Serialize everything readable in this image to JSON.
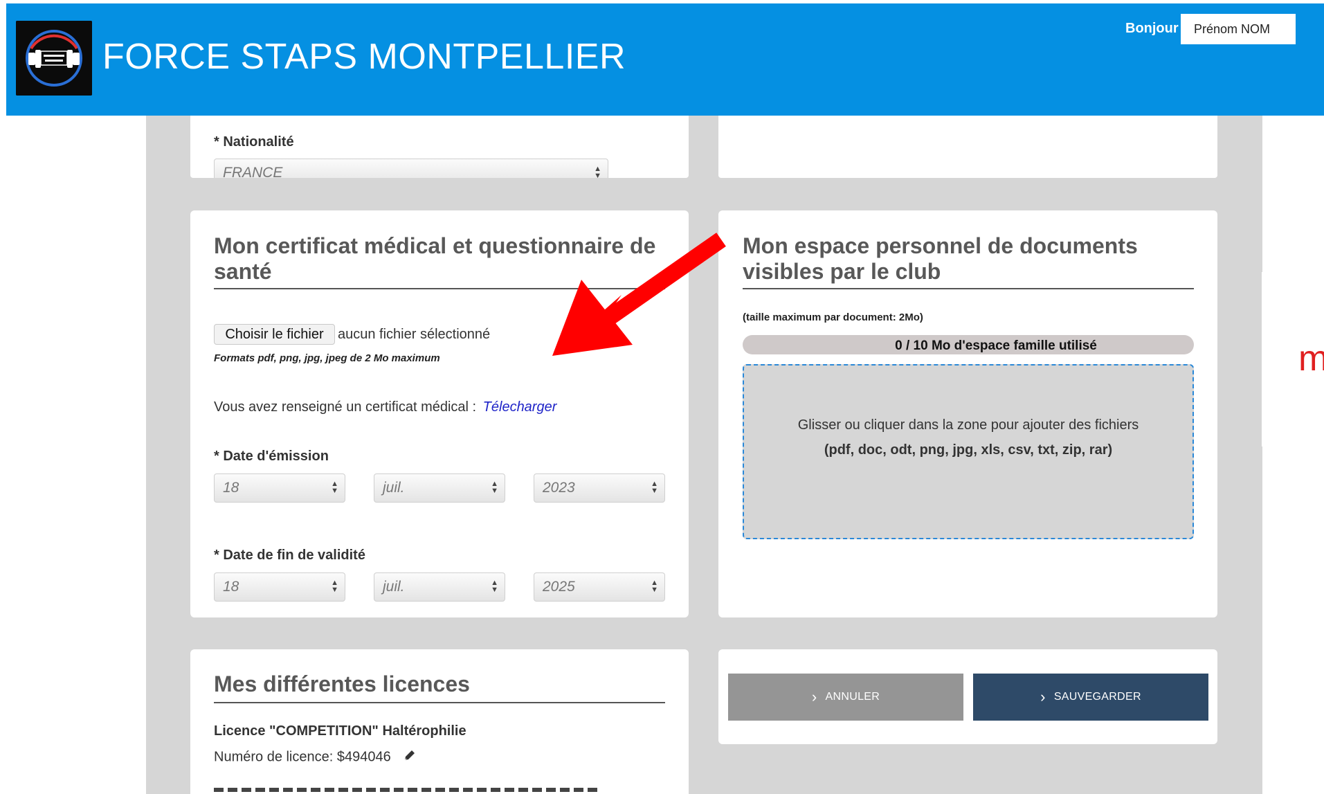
{
  "header": {
    "site_title": "FORCE STAPS MONTPELLIER",
    "greeting": "Bonjour",
    "user_name": "Prénom NOM",
    "logo_icon": "dumbbell-logo-icon"
  },
  "nationality": {
    "label": "* Nationalité",
    "value": "FRANCE"
  },
  "medical": {
    "title": "Mon certificat médical et questionnaire de santé",
    "file_button": "Choisir le fichier",
    "file_status": "aucun fichier sélectionné",
    "formats_hint": "Formats pdf, png, jpg, jpeg de 2 Mo maximum",
    "certificate_text": "Vous avez renseigné un certificat médical :",
    "download_link": "Télecharger",
    "issue_label": "* Date d'émission",
    "issue_day": "18",
    "issue_month": "juil.",
    "issue_year": "2023",
    "end_label": "* Date de fin de validité",
    "end_day": "18",
    "end_month": "juil.",
    "end_year": "2025"
  },
  "documents": {
    "title": "Mon espace personnel de documents visibles par le club",
    "max_size": "(taille maximum par document: 2Mo)",
    "usage_text": "0 / 10 Mo d'espace famille utilisé",
    "usage_fraction": 0,
    "dropzone_line1": "Glisser ou cliquer dans la zone pour ajouter des fichiers",
    "dropzone_line2": "(pdf, doc, odt, png, jpg, xls, csv, txt, zip, rar)"
  },
  "licences": {
    "title": "Mes différentes licences",
    "licence_name": "Licence \"COMPETITION\" Haltérophilie",
    "licence_number": "Numéro de licence: $494046"
  },
  "actions": {
    "cancel": "ANNULER",
    "save": "SAUVEGARDER"
  },
  "side_fragment": "m",
  "colors": {
    "header": "#0590e2",
    "arrow": "#ff0000",
    "cancel_button": "#959595",
    "save_button": "#2e4a68",
    "link": "#1f24c8",
    "dropzone_border": "#2a88d8"
  }
}
